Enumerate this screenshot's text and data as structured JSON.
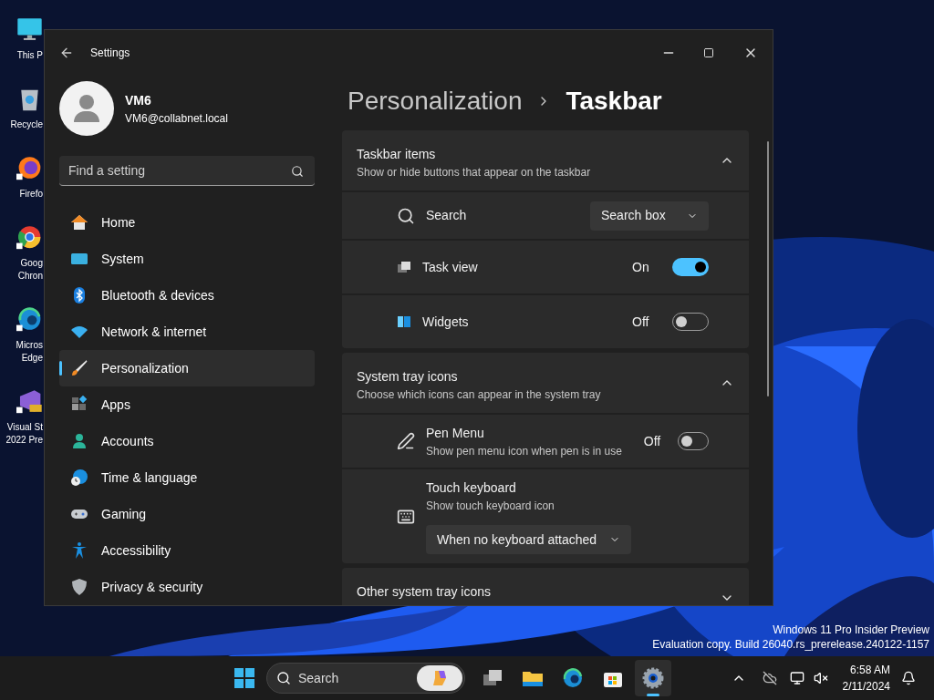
{
  "desktop_icons": [
    {
      "lines": [
        "This P"
      ]
    },
    {
      "lines": [
        "Recycle"
      ]
    },
    {
      "lines": [
        "Firefo"
      ]
    },
    {
      "lines": [
        "Goog",
        "Chron"
      ]
    },
    {
      "lines": [
        "Micros",
        "Edge"
      ]
    },
    {
      "lines": [
        "Visual St",
        "2022 Pre"
      ]
    }
  ],
  "window": {
    "title": "Settings"
  },
  "user": {
    "name": "VM6",
    "email": "VM6@collabnet.local"
  },
  "search": {
    "placeholder": "Find a setting"
  },
  "nav": [
    {
      "label": "Home",
      "selected": false
    },
    {
      "label": "System",
      "selected": false
    },
    {
      "label": "Bluetooth & devices",
      "selected": false
    },
    {
      "label": "Network & internet",
      "selected": false
    },
    {
      "label": "Personalization",
      "selected": true
    },
    {
      "label": "Apps",
      "selected": false
    },
    {
      "label": "Accounts",
      "selected": false
    },
    {
      "label": "Time & language",
      "selected": false
    },
    {
      "label": "Gaming",
      "selected": false
    },
    {
      "label": "Accessibility",
      "selected": false
    },
    {
      "label": "Privacy & security",
      "selected": false
    }
  ],
  "breadcrumb": [
    "Personalization",
    "Taskbar"
  ],
  "sections": [
    {
      "title": "Taskbar items",
      "description": "Show or hide buttons that appear on the taskbar",
      "expanded": true,
      "items": [
        {
          "kind": "dropdown",
          "label": "Search",
          "value": "Search box"
        },
        {
          "kind": "toggle",
          "label": "Task view",
          "on": true,
          "state_text": "On"
        },
        {
          "kind": "toggle",
          "label": "Widgets",
          "on": false,
          "state_text": "Off"
        }
      ]
    },
    {
      "title": "System tray icons",
      "description": "Choose which icons can appear in the system tray",
      "expanded": true,
      "items": [
        {
          "kind": "toggle",
          "label": "Pen Menu",
          "description": "Show pen menu icon when pen is in use",
          "on": false,
          "state_text": "Off"
        },
        {
          "kind": "stacked_dropdown",
          "label": "Touch keyboard",
          "description": "Show touch keyboard icon",
          "value": "When no keyboard attached"
        }
      ]
    },
    {
      "title": "Other system tray icons",
      "expanded": false
    }
  ],
  "os_notice": [
    "Windows 11 Pro Insider Preview",
    "Evaluation copy. Build 26040.rs_prerelease.240122-1157"
  ],
  "taskbar": {
    "search_placeholder": "Search",
    "apps": [
      {
        "selected": false
      },
      {
        "selected": false
      },
      {
        "selected": false
      },
      {
        "selected": false
      },
      {
        "selected": true
      }
    ],
    "time": "6:58 AM",
    "date": "2/11/2024"
  }
}
